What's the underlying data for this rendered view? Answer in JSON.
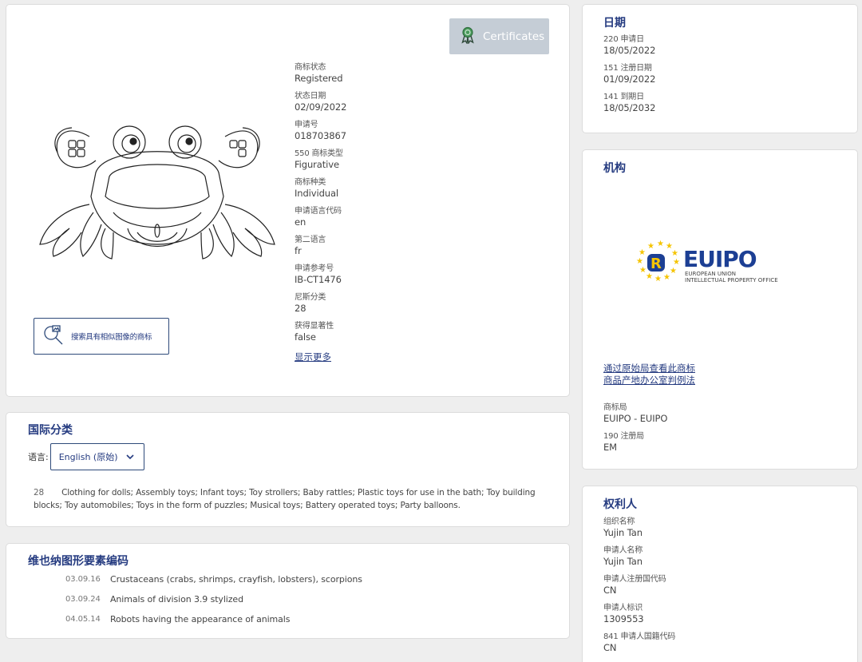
{
  "main": {
    "certificates_label": "Certificates",
    "similar_search_label": "搜索具有相似图像的商标",
    "show_more": "显示更多",
    "fields": [
      {
        "label": "商标状态",
        "value": "Registered"
      },
      {
        "label": "状态日期",
        "value": "02/09/2022"
      },
      {
        "label": "申请号",
        "value": "018703867"
      },
      {
        "label": "550 商标类型",
        "value": "Figurative"
      },
      {
        "label": "商标种类",
        "value": "Individual"
      },
      {
        "label": "申请语言代码",
        "value": "en"
      },
      {
        "label": "第二语言",
        "value": "fr"
      },
      {
        "label": "申请参考号",
        "value": "IB-CT1476"
      },
      {
        "label": "尼斯分类",
        "value": "28"
      },
      {
        "label": "获得显著性",
        "value": "false"
      }
    ]
  },
  "classification": {
    "title": "国际分类",
    "lang_label": "语言:",
    "lang_value": "English (原始)",
    "class_number": "28",
    "class_text": "Clothing for dolls; Assembly toys; Infant toys; Toy strollers; Baby rattles; Plastic toys for use in the bath; Toy building blocks; Toy automobiles; Toys in the form of puzzles; Musical toys; Battery operated toys; Party balloons."
  },
  "vienna": {
    "title": "维也纳图形要素编码",
    "items": [
      {
        "code": "03.09.16",
        "text": "Crustaceans (crabs, shrimps, crayfish, lobsters), scorpions"
      },
      {
        "code": "03.09.24",
        "text": "Animals of division 3.9 stylized"
      },
      {
        "code": "04.05.14",
        "text": "Robots having the appearance of animals"
      }
    ]
  },
  "dates": {
    "title": "日期",
    "fields": [
      {
        "label": "220 申请日",
        "value": "18/05/2022"
      },
      {
        "label": "151 注册日期",
        "value": "01/09/2022"
      },
      {
        "label": "141 到期日",
        "value": "18/05/2032"
      }
    ]
  },
  "institution": {
    "title": "机构",
    "logo_main": "EUIPO",
    "logo_sub1": "EUROPEAN UNION",
    "logo_sub2": "INTELLECTUAL PROPERTY OFFICE",
    "link1": "通过原始局查看此商标",
    "link2": "商品产地办公室判例法",
    "fields": [
      {
        "label": "商标局",
        "value": "EUIPO - EUIPO"
      },
      {
        "label": "190 注册局",
        "value": "EM"
      }
    ]
  },
  "owner": {
    "title": "权利人",
    "fields": [
      {
        "label": "组织名称",
        "value": "Yujin Tan"
      },
      {
        "label": "申请人名称",
        "value": "Yujin Tan"
      },
      {
        "label": "申请人注册国代码",
        "value": "CN"
      },
      {
        "label": "申请人标识",
        "value": "1309553"
      },
      {
        "label": "841 申请人国籍代码",
        "value": "CN"
      }
    ]
  },
  "colors": {
    "accent": "#253b80",
    "certificate_button": "#c5cdd6",
    "euipo_blue": "#1c3f94",
    "euipo_yellow": "#f5c400"
  }
}
